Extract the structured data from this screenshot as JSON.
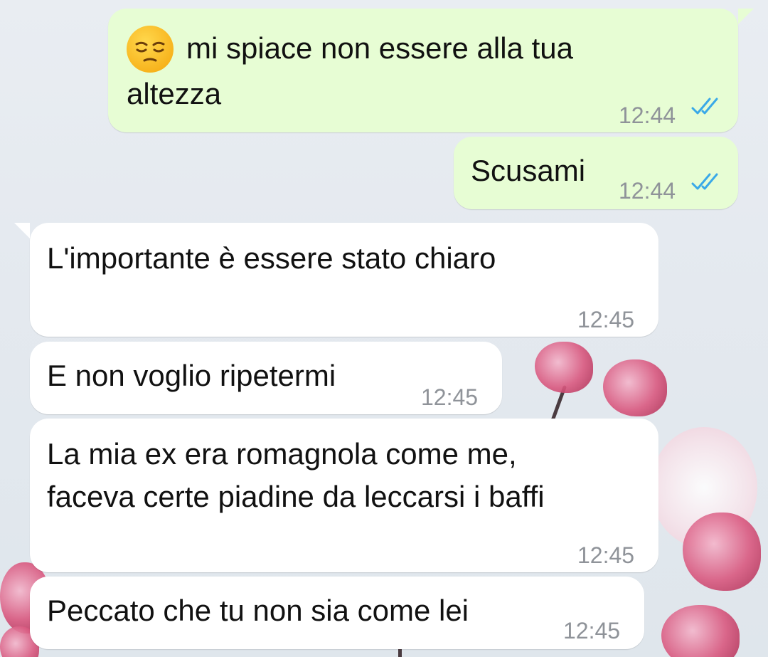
{
  "colors": {
    "outgoing_bubble": "#e7fdd4",
    "incoming_bubble": "#ffffff",
    "timestamp": "#8f9399",
    "read_ticks": "#3aa9e8"
  },
  "messages": [
    {
      "direction": "outgoing",
      "emoji": "pensive-face-icon",
      "lines": [
        "mi spiace non essere alla tua",
        "altezza"
      ],
      "time": "12:44",
      "status": "read"
    },
    {
      "direction": "outgoing",
      "lines": [
        "Scusami"
      ],
      "time": "12:44",
      "status": "read"
    },
    {
      "direction": "incoming",
      "lines": [
        "L'importante è essere stato chiaro"
      ],
      "time": "12:45"
    },
    {
      "direction": "incoming",
      "lines": [
        "E non voglio ripetermi"
      ],
      "time": "12:45"
    },
    {
      "direction": "incoming",
      "lines": [
        "La mia ex era romagnola come me,",
        "faceva certe piadine da leccarsi i baffi"
      ],
      "time": "12:45"
    },
    {
      "direction": "incoming",
      "lines": [
        "Peccato che tu non sia come lei"
      ],
      "time": "12:45"
    }
  ]
}
